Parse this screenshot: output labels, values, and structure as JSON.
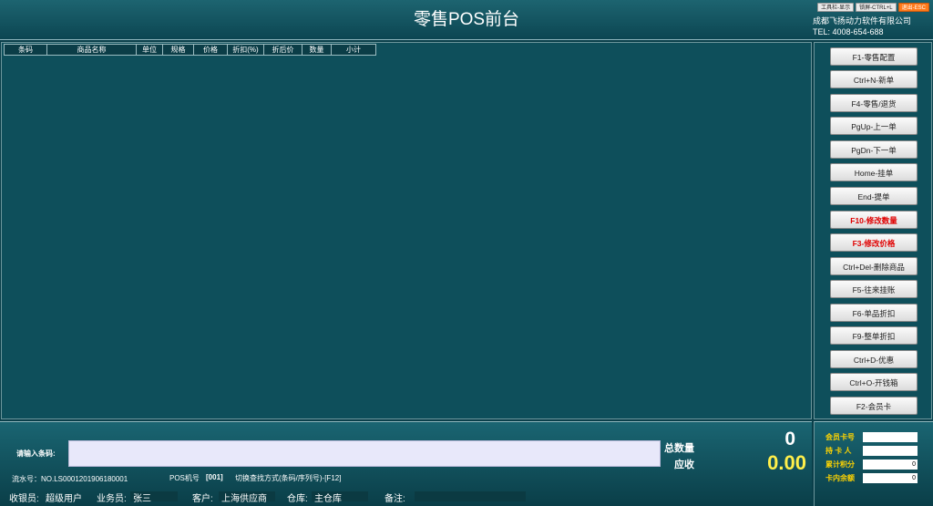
{
  "header": {
    "title": "零售POS前台",
    "toolbar_show": "工具栏-显示",
    "lock_screen": "锁屏-CTRL+L",
    "exit": "退出-ESC",
    "company": "成都飞扬动力软件有限公司",
    "tel": "TEL: 4008-654-688"
  },
  "grid": {
    "columns": [
      "条码",
      "商品名称",
      "单位",
      "规格",
      "价格",
      "折扣(%)",
      "折后价",
      "数量",
      "小计"
    ],
    "rows": []
  },
  "sidebar": {
    "buttons": [
      {
        "label": "F1-零售配置",
        "highlight": false
      },
      {
        "label": "Ctrl+N-新单",
        "highlight": false
      },
      {
        "label": "F4-零售/退货",
        "highlight": false
      },
      {
        "label": "PgUp-上一单",
        "highlight": false
      },
      {
        "label": "PgDn-下一单",
        "highlight": false
      },
      {
        "label": "Home-挂单",
        "highlight": false
      },
      {
        "label": "End-提单",
        "highlight": false
      },
      {
        "label": "F10-修改数量",
        "highlight": true
      },
      {
        "label": "F3-修改价格",
        "highlight": true
      },
      {
        "label": "Ctrl+Del-删除商品",
        "highlight": false
      },
      {
        "label": "F5-往来挂账",
        "highlight": false
      },
      {
        "label": "F6-单品折扣",
        "highlight": false
      },
      {
        "label": "F9-整单折扣",
        "highlight": false
      },
      {
        "label": "Ctrl+D-优惠",
        "highlight": false
      },
      {
        "label": "Ctrl+O-开钱箱",
        "highlight": false
      },
      {
        "label": "F2-会员卡",
        "highlight": false
      }
    ]
  },
  "bottom": {
    "barcode_label": "请输入条码:",
    "barcode_value": "",
    "total_qty_label": "总数量",
    "due_label": "应收",
    "total_qty": "0",
    "due_amount": "0.00",
    "serial_label": "流水号：NO.LS0001201906180001",
    "pos_label": "POS机号",
    "pos_value": "[001]",
    "switch_label": "切换查找方式(条码/序列号)-[F12]",
    "cashier_label": "收银员:",
    "cashier_value": "超级用户",
    "salesman_label": "业务员:",
    "salesman_value": "张三",
    "customer_label": "客户:",
    "customer_value": "上海供应商",
    "warehouse_label": "仓库:",
    "warehouse_value": "主仓库",
    "remark_label": "备注:",
    "remark_value": ""
  },
  "member": {
    "card_no_label": "会员卡号",
    "card_no": "",
    "holder_label": "持 卡 人",
    "holder": "",
    "points_label": "累计积分",
    "points": "0",
    "balance_label": "卡内余额",
    "balance": "0"
  },
  "colors": {
    "background": "#0e4f5b",
    "amount": "#ffef4a",
    "highlight_button_text": "#e00000",
    "member_label": "#ffd400",
    "exit_button": "#ff7a1a"
  }
}
